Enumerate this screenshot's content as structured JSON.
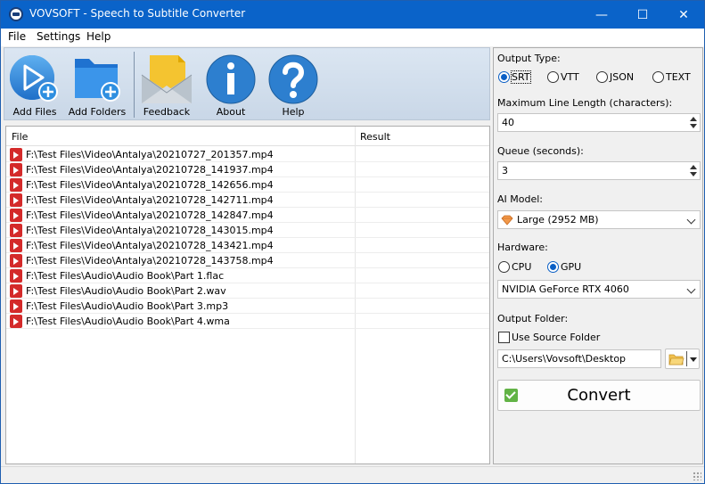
{
  "window": {
    "title": "VOVSOFT - Speech to Subtitle Converter",
    "minimize": "—",
    "maximize": "☐",
    "close": "✕"
  },
  "menu": [
    "File",
    "Settings",
    "Help"
  ],
  "toolbar": {
    "add_files": "Add Files",
    "add_folders": "Add Folders",
    "feedback": "Feedback",
    "about": "About",
    "help": "Help"
  },
  "list": {
    "columns": [
      "File",
      "Result"
    ],
    "rows": [
      {
        "file": "F:\\Test Files\\Video\\Antalya\\20210727_201357.mp4",
        "result": ""
      },
      {
        "file": "F:\\Test Files\\Video\\Antalya\\20210728_141937.mp4",
        "result": ""
      },
      {
        "file": "F:\\Test Files\\Video\\Antalya\\20210728_142656.mp4",
        "result": ""
      },
      {
        "file": "F:\\Test Files\\Video\\Antalya\\20210728_142711.mp4",
        "result": ""
      },
      {
        "file": "F:\\Test Files\\Video\\Antalya\\20210728_142847.mp4",
        "result": ""
      },
      {
        "file": "F:\\Test Files\\Video\\Antalya\\20210728_143015.mp4",
        "result": ""
      },
      {
        "file": "F:\\Test Files\\Video\\Antalya\\20210728_143421.mp4",
        "result": ""
      },
      {
        "file": "F:\\Test Files\\Video\\Antalya\\20210728_143758.mp4",
        "result": ""
      },
      {
        "file": "F:\\Test Files\\Audio\\Audio Book\\Part 1.flac",
        "result": ""
      },
      {
        "file": "F:\\Test Files\\Audio\\Audio Book\\Part 2.wav",
        "result": ""
      },
      {
        "file": "F:\\Test Files\\Audio\\Audio Book\\Part 3.mp3",
        "result": ""
      },
      {
        "file": "F:\\Test Files\\Audio\\Audio Book\\Part 4.wma",
        "result": ""
      }
    ]
  },
  "settings": {
    "output_type_label": "Output Type:",
    "output_types": [
      "SRT",
      "VTT",
      "JSON",
      "TEXT"
    ],
    "selected_output_type": "SRT",
    "max_line_label": "Maximum Line Length (characters):",
    "max_line_value": "40",
    "queue_label": "Queue (seconds):",
    "queue_value": "3",
    "ai_model_label": "AI Model:",
    "ai_model_value": "Large (2952 MB)",
    "hardware_label": "Hardware:",
    "hardware_options": [
      "CPU",
      "GPU"
    ],
    "selected_hardware": "GPU",
    "gpu_value": "NVIDIA GeForce RTX 4060",
    "output_folder_label": "Output Folder:",
    "use_source_folder_label": "Use Source Folder",
    "use_source_folder_checked": false,
    "output_folder_value": "C:\\Users\\Vovsoft\\Desktop",
    "convert_label": "Convert"
  },
  "colors": {
    "titlebar": "#0a63c9",
    "accent": "#0a5fc5",
    "convert_check": "#62b346",
    "file_icon": "#d42a2a"
  }
}
